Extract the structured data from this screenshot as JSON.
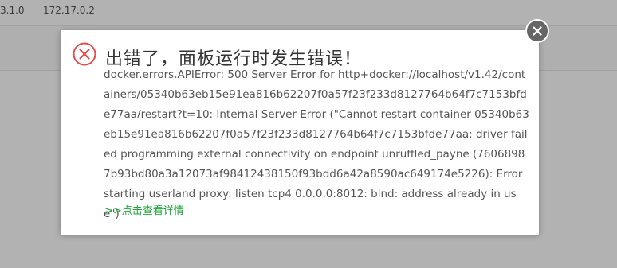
{
  "background": {
    "cells": [
      "3.1.0",
      "172.17.0.2"
    ]
  },
  "dialog": {
    "title": "出错了，面板运行时发生错误！",
    "message": "docker.errors.APIError: 500 Server Error for http+docker://localhost/v1.42/containers/05340b63eb15e91ea816b62207f0a57f23f233d8127764b64f7c7153bfde77aa/restart?t=10: Internal Server Error (\"Cannot restart container 05340b63eb15e91ea816b62207f0a57f23f233d8127764b64f7c7153bfde77aa: driver failed programming external connectivity on endpoint unruffled_payne (76068987b93bd80a3a12073af98412438150f93bdd6a42a8590ac649174e5226): Error starting userland proxy: listen tcp4 0.0.0.0:8012: bind: address already in use\")",
    "details_link": ">>点击查看详情",
    "icons": {
      "error": "error-circle-icon",
      "close": "close-icon"
    },
    "colors": {
      "error_red": "#e54b4b",
      "link_green": "#20a53a",
      "close_bg": "#666666"
    }
  }
}
